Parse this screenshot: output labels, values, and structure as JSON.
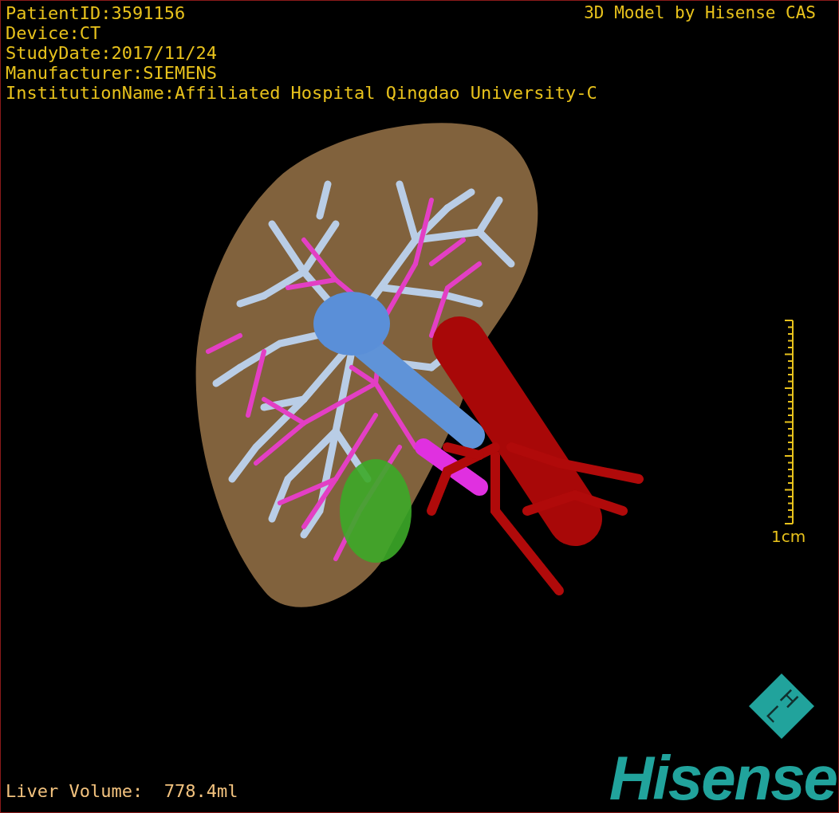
{
  "viewer": {
    "info_lines": [
      "PatientID:3591156",
      "Device:CT",
      "StudyDate:2017/11/24",
      "Manufacturer:SIEMENS",
      "InstitutionName:Affiliated Hospital Qingdao University-C"
    ],
    "caption": "3D Model by Hisense CAS",
    "scale_label": "1cm",
    "liver_volume": "Liver Volume:  778.4ml",
    "logo": {
      "mark_letters": [
        "H",
        "L"
      ],
      "wordmark": "Hisense"
    }
  }
}
